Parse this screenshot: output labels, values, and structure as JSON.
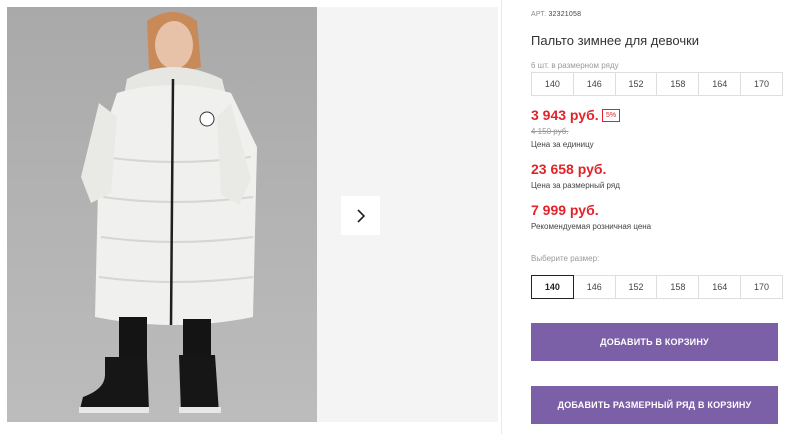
{
  "gallery": {
    "photo_alt": "",
    "next_icon": "chevron-right-icon"
  },
  "product": {
    "article_prefix": "АРТ.",
    "article": "32321058",
    "title": "Пальто зимнее для девочки",
    "pack_label": "6 шт. в размерном ряду",
    "pack_sizes": [
      "140",
      "146",
      "152",
      "158",
      "164",
      "170"
    ],
    "price": "3 943 руб.",
    "discount": "5%",
    "old_price": "4 150 руб.",
    "unit_label": "Цена за единицу",
    "pack_price": "23 658 руб.",
    "pack_price_label": "Цена за размерный ряд",
    "rrp_price": "7 999 руб.",
    "rrp_label": "Рекомендуемая розничная цена",
    "choose_size_label": "Выберите размер:",
    "sizes": [
      "140",
      "146",
      "152",
      "158",
      "164",
      "170"
    ],
    "selected_size": "140"
  },
  "actions": {
    "add_to_cart": "ДОБАВИТЬ В КОРЗИНУ",
    "add_pack_to_cart": "ДОБАВИТЬ РАЗМЕРНЫЙ РЯД В КОРЗИНУ"
  },
  "colors": {
    "price_red": "#e2242a",
    "button_purple": "#7c60a7"
  }
}
